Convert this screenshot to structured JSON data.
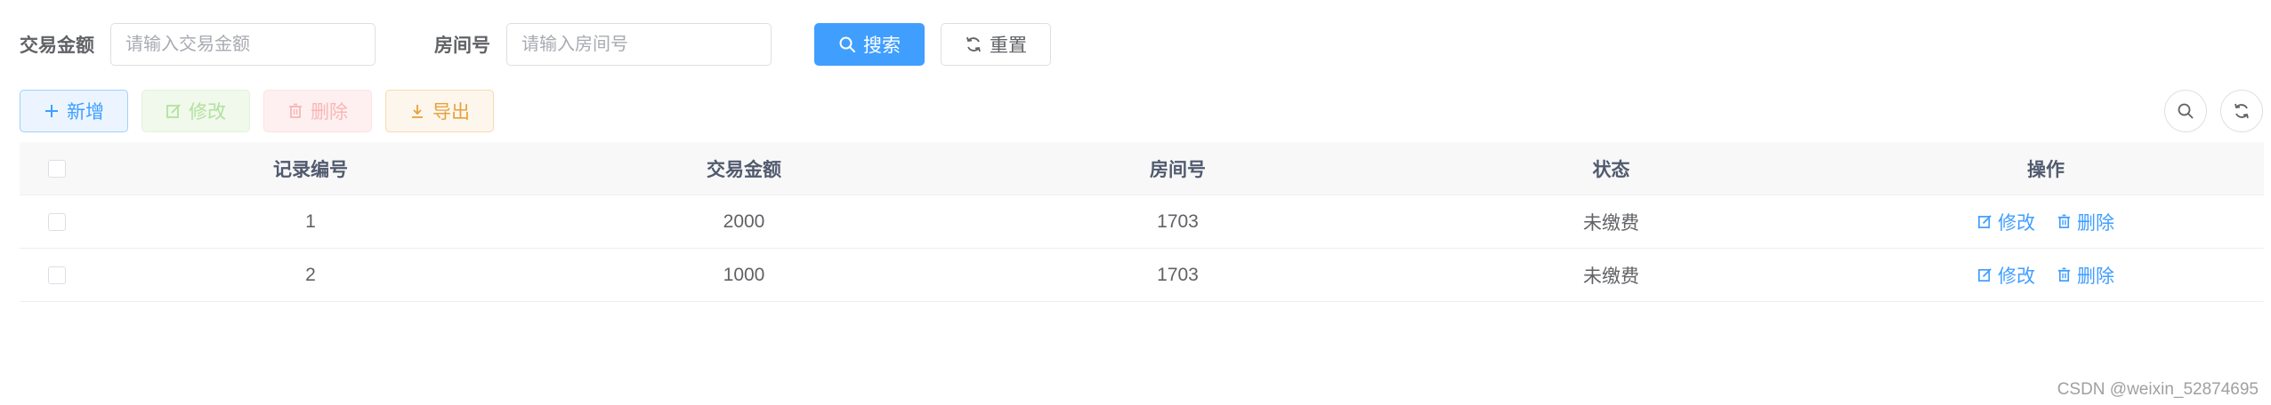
{
  "search_form": {
    "amount_label": "交易金额",
    "amount_placeholder": "请输入交易金额",
    "room_label": "房间号",
    "room_placeholder": "请输入房间号",
    "search_button": "搜索",
    "reset_button": "重置"
  },
  "toolbar": {
    "add_button": "新增",
    "edit_button": "修改",
    "delete_button": "删除",
    "export_button": "导出"
  },
  "table": {
    "columns": [
      "记录编号",
      "交易金额",
      "房间号",
      "状态",
      "操作"
    ],
    "rows": [
      {
        "id": "1",
        "amount": "2000",
        "room": "1703",
        "status": "未缴费"
      },
      {
        "id": "2",
        "amount": "1000",
        "room": "1703",
        "status": "未缴费"
      }
    ],
    "row_actions": {
      "edit": "修改",
      "delete": "删除"
    }
  },
  "colors": {
    "primary": "#409eff",
    "success_light": "#b3e19d",
    "danger_light": "#fab6b6",
    "warning": "#e6a23c"
  },
  "watermark": "CSDN @weixin_52874695"
}
